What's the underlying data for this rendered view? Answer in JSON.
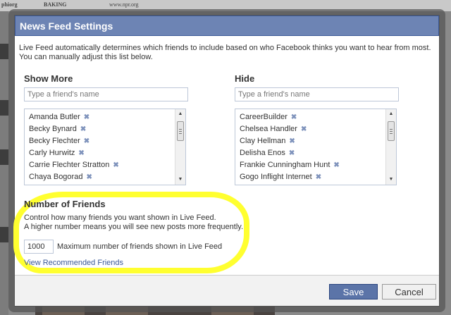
{
  "background": {
    "top_texts": [
      "phiorg",
      "BAKING",
      "www.npr.org"
    ]
  },
  "dialog": {
    "title": "News Feed Settings",
    "description_line1": "Live Feed automatically determines which friends to include based on who Facebook thinks you want to hear from most.",
    "description_line2": "You can manually adjust this list below.",
    "show_more": {
      "title": "Show More",
      "search_placeholder": "Type a friend's name",
      "friends": [
        "Amanda Butler",
        "Becky Bynard",
        "Becky Flechter",
        "Carly Hurwitz",
        "Carrie Flechter Stratton",
        "Chaya Bogorad"
      ]
    },
    "hide": {
      "title": "Hide",
      "search_placeholder": "Type a friend's name",
      "friends": [
        "CareerBuilder",
        "Chelsea Handler",
        "Clay Hellman",
        "Delisha Enos",
        "Frankie Cunningham Hunt",
        "Gogo Inflight Internet"
      ]
    },
    "remove_glyph": "✖",
    "number_of_friends": {
      "title": "Number of Friends",
      "desc_line1": "Control how many friends you want shown in Live Feed.",
      "desc_line2": "A higher number means you will see new posts more frequently.",
      "value": "1000",
      "input_label": "Maximum number of friends shown in Live Feed",
      "link": "View Recommended Friends"
    },
    "buttons": {
      "save": "Save",
      "cancel": "Cancel"
    },
    "colors": {
      "title_bar": "#6d84b4",
      "highlight": "#ffff30",
      "save_button": "#5b74a8",
      "link": "#3b5998"
    }
  }
}
